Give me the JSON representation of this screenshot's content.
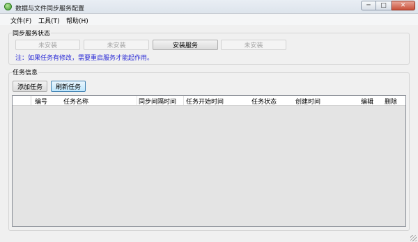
{
  "window": {
    "title": "数据与文件同步服务配置",
    "minimize_glyph": "─",
    "maximize_glyph": "□",
    "close_glyph": "✕"
  },
  "menu": {
    "items": [
      {
        "label": "文件(F)"
      },
      {
        "label": "工具(T)"
      },
      {
        "label": "帮助(H)"
      }
    ]
  },
  "sync_status": {
    "title": "同步服务状态",
    "buttons": [
      {
        "label": "未安装",
        "enabled": false
      },
      {
        "label": "未安装",
        "enabled": false
      },
      {
        "label": "安装服务",
        "enabled": true
      },
      {
        "label": "未安装",
        "enabled": false
      }
    ],
    "note": "注：如果任务有修改，需要重启服务才能起作用。",
    "note_color": "#2b2bd6"
  },
  "task_info": {
    "title": "任务信息",
    "add_button": "添加任务",
    "refresh_button": "刷新任务",
    "columns": [
      "编号",
      "任务名称",
      "同步间隔时间",
      "任务开始时间",
      "任务状态",
      "创建时间",
      "编辑",
      "删除"
    ],
    "rows": []
  },
  "colors": {
    "window_bg": "#f0f0f0",
    "grid_bg": "#e4e4e4",
    "focus_border": "#3c7fb1"
  }
}
